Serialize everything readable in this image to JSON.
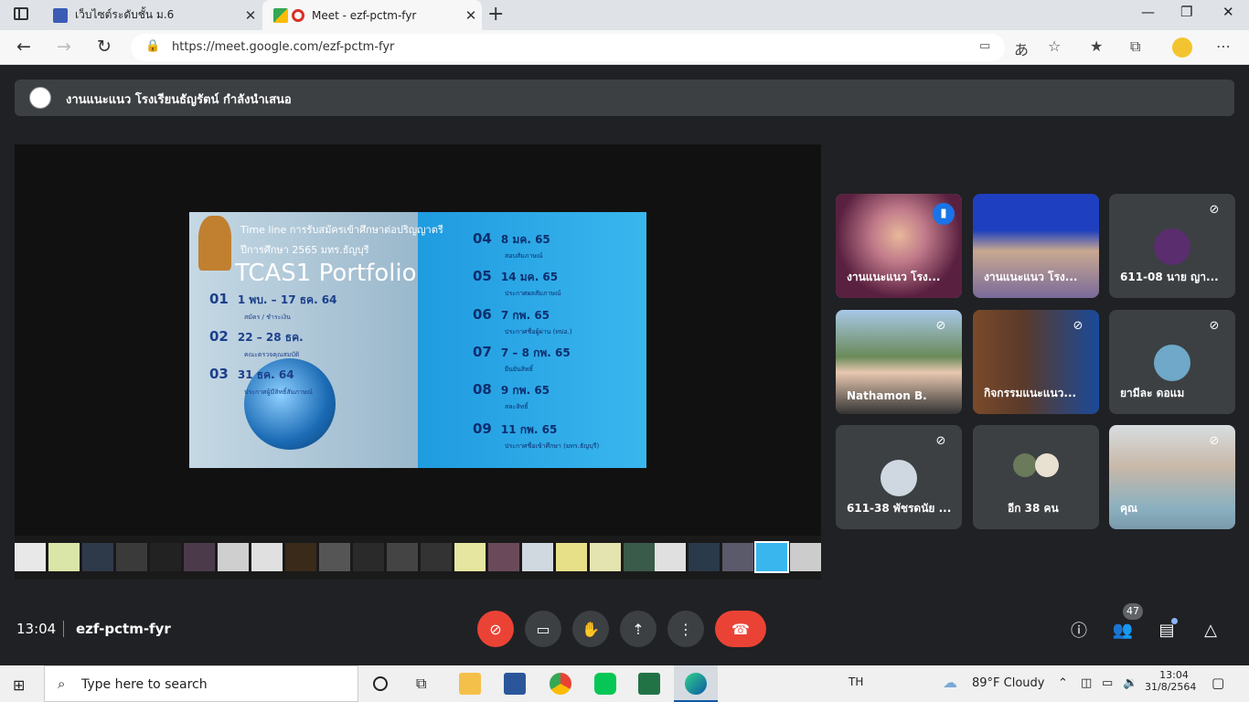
{
  "browser": {
    "tabs": [
      {
        "label": "เว็บไซต์ระดับชั้น ม.6"
      },
      {
        "label": "Meet - ezf-pctm-fyr"
      }
    ],
    "url": "https://meet.google.com/ezf-pctm-fyr"
  },
  "presenting": {
    "text": "งานแนะแนว โรงเรียนธัญรัตน์ กำลังนำเสนอ"
  },
  "slide": {
    "title": "Time line การรับสมัครเข้าศึกษาต่อปริญญาตรี",
    "subtitle": "ปีการศึกษา 2565 มทร.ธัญบุรี",
    "big": "TCAS1 Portfolio",
    "left": [
      {
        "num": "01",
        "date": "1 พบ. – 17 ธค. 64",
        "note": "สมัคร / ชำระเงิน"
      },
      {
        "num": "02",
        "date": "22 – 28 ธค.",
        "note": "คณะตรวจคุณสมบัติ"
      },
      {
        "num": "03",
        "date": "31 ธค. 64",
        "note": "ประกาศผู้มีสิทธิ์สัมภาษณ์"
      }
    ],
    "right": [
      {
        "num": "04",
        "date": "8 มค. 65",
        "note": "สอบสัมภาษณ์"
      },
      {
        "num": "05",
        "date": "14 มค. 65",
        "note": "ประกาศผลสัมภาษณ์"
      },
      {
        "num": "06",
        "date": "7 กพ. 65",
        "note": "ประกาศชื่อผู้ผ่าน (ทปอ.)"
      },
      {
        "num": "07",
        "date": "7 – 8 กพ. 65",
        "note": "ยืนยันสิทธิ์"
      },
      {
        "num": "08",
        "date": "9 กพ. 65",
        "note": "สละสิทธิ์"
      },
      {
        "num": "09",
        "date": "11 กพ. 65",
        "note": "ประกาศชื่อเข้าศึกษา (มทร.ธัญบุรี)"
      }
    ]
  },
  "participants": [
    {
      "name": "งานแนะแนว โรง...",
      "color": "#b03a6a"
    },
    {
      "name": "งานแนะแนว โรง...",
      "color": "#1e3fbf"
    },
    {
      "name": "611-08 นาย ญา...",
      "color": "#5a2d6e"
    },
    {
      "name": "Nathamon B.",
      "color": "#6a8a5a"
    },
    {
      "name": "กิจกรรมแนะแนว...",
      "color": "#7a5a3a"
    },
    {
      "name": "ยามีละ ดอแม",
      "color": "#6fa8c8"
    },
    {
      "name": "611-38 พัชรดนัย ...",
      "color": "#cfd8e0"
    },
    {
      "name": "อีก 38 คน",
      "color": "#5f6368"
    },
    {
      "name": "คุณ",
      "color": "#b8c4cc"
    }
  ],
  "meeting": {
    "time": "13:04",
    "code": "ezf-pctm-fyr",
    "people_count": "47"
  },
  "taskbar": {
    "search_placeholder": "Type here to search",
    "lang": "TH",
    "weather": "89°F  Cloudy",
    "clock_time": "13:04",
    "clock_date": "31/8/2564"
  },
  "colors": {
    "end_call": "#ea4335",
    "mic_off": "#ea4335",
    "active_speaker": "#8ab4f8"
  }
}
